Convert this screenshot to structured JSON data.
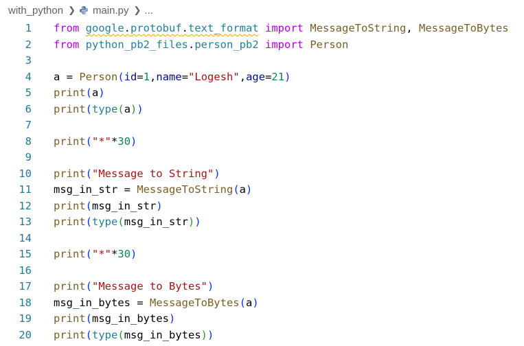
{
  "breadcrumb": {
    "folder": "with_python",
    "file": "main.py",
    "more": "..."
  },
  "lines": [
    {
      "n": "1",
      "tokens": [
        {
          "t": "from",
          "c": "keyword"
        },
        {
          "t": " ",
          "c": "plain"
        },
        {
          "t": "google",
          "c": "module",
          "sq": true
        },
        {
          "t": ".",
          "c": "plain",
          "sq": true
        },
        {
          "t": "protobuf",
          "c": "module",
          "sq": true
        },
        {
          "t": ".",
          "c": "plain",
          "sq": true
        },
        {
          "t": "text_format",
          "c": "module",
          "sq": true
        },
        {
          "t": " ",
          "c": "plain"
        },
        {
          "t": "import",
          "c": "keyword"
        },
        {
          "t": " ",
          "c": "plain"
        },
        {
          "t": "MessageToString",
          "c": "func"
        },
        {
          "t": ", ",
          "c": "plain"
        },
        {
          "t": "MessageToBytes",
          "c": "func"
        }
      ]
    },
    {
      "n": "2",
      "tokens": [
        {
          "t": "from",
          "c": "keyword"
        },
        {
          "t": " ",
          "c": "plain"
        },
        {
          "t": "python_pb2_files",
          "c": "module"
        },
        {
          "t": ".",
          "c": "plain"
        },
        {
          "t": "person_pb2",
          "c": "module"
        },
        {
          "t": " ",
          "c": "plain"
        },
        {
          "t": "import",
          "c": "keyword"
        },
        {
          "t": " ",
          "c": "plain"
        },
        {
          "t": "Person",
          "c": "func"
        }
      ]
    },
    {
      "n": "3",
      "tokens": []
    },
    {
      "n": "4",
      "tokens": [
        {
          "t": "a",
          "c": "plain"
        },
        {
          "t": " = ",
          "c": "op"
        },
        {
          "t": "Person",
          "c": "func"
        },
        {
          "t": "(",
          "c": "paren1"
        },
        {
          "t": "id",
          "c": "param"
        },
        {
          "t": "=",
          "c": "op"
        },
        {
          "t": "1",
          "c": "number"
        },
        {
          "t": ",",
          "c": "plain"
        },
        {
          "t": "name",
          "c": "param"
        },
        {
          "t": "=",
          "c": "op"
        },
        {
          "t": "\"Logesh\"",
          "c": "string"
        },
        {
          "t": ",",
          "c": "plain"
        },
        {
          "t": "age",
          "c": "param"
        },
        {
          "t": "=",
          "c": "op"
        },
        {
          "t": "21",
          "c": "number"
        },
        {
          "t": ")",
          "c": "paren1"
        }
      ]
    },
    {
      "n": "5",
      "tokens": [
        {
          "t": "print",
          "c": "func"
        },
        {
          "t": "(",
          "c": "paren1"
        },
        {
          "t": "a",
          "c": "plain"
        },
        {
          "t": ")",
          "c": "paren1"
        }
      ]
    },
    {
      "n": "6",
      "tokens": [
        {
          "t": "print",
          "c": "func"
        },
        {
          "t": "(",
          "c": "paren1"
        },
        {
          "t": "type",
          "c": "module"
        },
        {
          "t": "(",
          "c": "paren2"
        },
        {
          "t": "a",
          "c": "plain"
        },
        {
          "t": ")",
          "c": "paren2"
        },
        {
          "t": ")",
          "c": "paren1"
        }
      ]
    },
    {
      "n": "7",
      "tokens": []
    },
    {
      "n": "8",
      "tokens": [
        {
          "t": "print",
          "c": "func"
        },
        {
          "t": "(",
          "c": "paren1"
        },
        {
          "t": "\"*\"",
          "c": "string"
        },
        {
          "t": "*",
          "c": "op"
        },
        {
          "t": "30",
          "c": "number"
        },
        {
          "t": ")",
          "c": "paren1"
        }
      ]
    },
    {
      "n": "9",
      "tokens": []
    },
    {
      "n": "10",
      "tokens": [
        {
          "t": "print",
          "c": "func"
        },
        {
          "t": "(",
          "c": "paren1"
        },
        {
          "t": "\"Message to String\"",
          "c": "string"
        },
        {
          "t": ")",
          "c": "paren1"
        }
      ]
    },
    {
      "n": "11",
      "tokens": [
        {
          "t": "msg_in_str",
          "c": "plain"
        },
        {
          "t": " = ",
          "c": "op"
        },
        {
          "t": "MessageToString",
          "c": "func"
        },
        {
          "t": "(",
          "c": "paren1"
        },
        {
          "t": "a",
          "c": "plain"
        },
        {
          "t": ")",
          "c": "paren1"
        }
      ]
    },
    {
      "n": "12",
      "tokens": [
        {
          "t": "print",
          "c": "func"
        },
        {
          "t": "(",
          "c": "paren1"
        },
        {
          "t": "msg_in_str",
          "c": "plain"
        },
        {
          "t": ")",
          "c": "paren1"
        }
      ]
    },
    {
      "n": "13",
      "tokens": [
        {
          "t": "print",
          "c": "func"
        },
        {
          "t": "(",
          "c": "paren1"
        },
        {
          "t": "type",
          "c": "module"
        },
        {
          "t": "(",
          "c": "paren2"
        },
        {
          "t": "msg_in_str",
          "c": "plain"
        },
        {
          "t": ")",
          "c": "paren2"
        },
        {
          "t": ")",
          "c": "paren1"
        }
      ]
    },
    {
      "n": "14",
      "tokens": []
    },
    {
      "n": "15",
      "tokens": [
        {
          "t": "print",
          "c": "func"
        },
        {
          "t": "(",
          "c": "paren1"
        },
        {
          "t": "\"*\"",
          "c": "string"
        },
        {
          "t": "*",
          "c": "op"
        },
        {
          "t": "30",
          "c": "number"
        },
        {
          "t": ")",
          "c": "paren1"
        }
      ]
    },
    {
      "n": "16",
      "tokens": []
    },
    {
      "n": "17",
      "tokens": [
        {
          "t": "print",
          "c": "func"
        },
        {
          "t": "(",
          "c": "paren1"
        },
        {
          "t": "\"Message to Bytes\"",
          "c": "string"
        },
        {
          "t": ")",
          "c": "paren1"
        }
      ]
    },
    {
      "n": "18",
      "tokens": [
        {
          "t": "msg_in_bytes",
          "c": "plain"
        },
        {
          "t": " = ",
          "c": "op"
        },
        {
          "t": "MessageToBytes",
          "c": "func"
        },
        {
          "t": "(",
          "c": "paren1"
        },
        {
          "t": "a",
          "c": "plain"
        },
        {
          "t": ")",
          "c": "paren1"
        }
      ]
    },
    {
      "n": "19",
      "tokens": [
        {
          "t": "print",
          "c": "func"
        },
        {
          "t": "(",
          "c": "paren1"
        },
        {
          "t": "msg_in_bytes",
          "c": "plain"
        },
        {
          "t": ")",
          "c": "paren1"
        }
      ]
    },
    {
      "n": "20",
      "tokens": [
        {
          "t": "print",
          "c": "func"
        },
        {
          "t": "(",
          "c": "paren1"
        },
        {
          "t": "type",
          "c": "module"
        },
        {
          "t": "(",
          "c": "paren2"
        },
        {
          "t": "msg_in_bytes",
          "c": "plain"
        },
        {
          "t": ")",
          "c": "paren2"
        },
        {
          "t": ")",
          "c": "paren1"
        }
      ]
    }
  ]
}
